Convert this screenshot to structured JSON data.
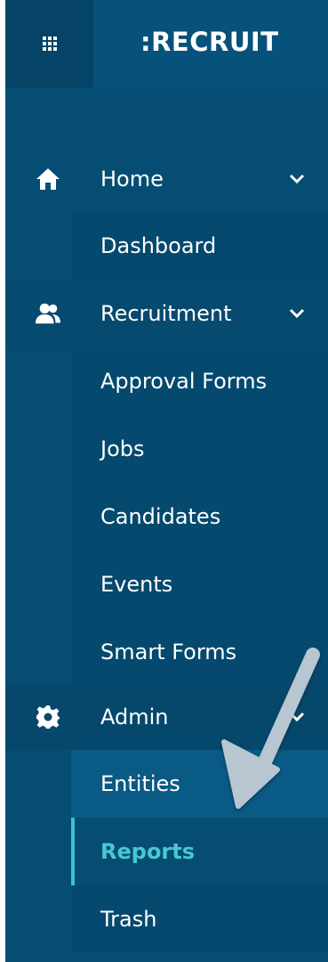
{
  "brand": ":RECRUIT",
  "icons": {
    "menu": "grid-icon",
    "home": "home-icon",
    "recruitment": "people-icon",
    "admin": "gear-icon",
    "expand": "chevron-down-icon"
  },
  "colors": {
    "sidebar_bg": "#064d74",
    "active_text": "#4ac7cf",
    "active_bar": "#3fc1c9"
  },
  "nav": {
    "home": {
      "label": "Home",
      "children": [
        "Dashboard"
      ]
    },
    "recruitment": {
      "label": "Recruitment",
      "children": [
        "Approval Forms",
        "Jobs",
        "Candidates",
        "Events",
        "Smart Forms"
      ]
    },
    "admin": {
      "label": "Admin",
      "children": [
        "Entities",
        "Reports",
        "Trash"
      ],
      "active_child": "Reports"
    }
  }
}
